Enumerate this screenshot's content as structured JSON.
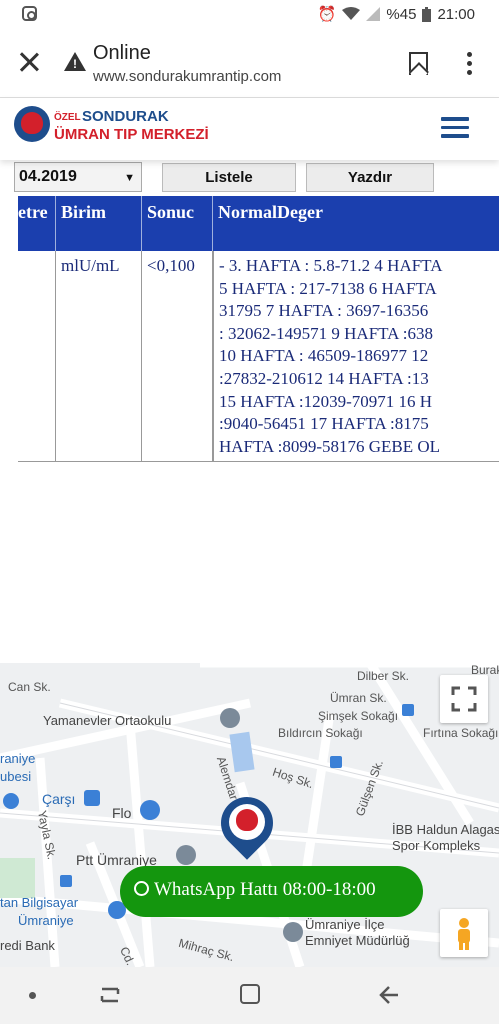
{
  "status_bar": {
    "battery": "%45",
    "time": "21:00"
  },
  "browser": {
    "title": "Online",
    "url": "www.sondurakumrantip.com"
  },
  "site": {
    "logo_ozel": "ÖZEL",
    "logo_sondurak": "SONDURAK",
    "logo_umran": "ÜMRAN TIP MERKEZİ"
  },
  "controls": {
    "date_value": "04.2019",
    "list_button": "Listele",
    "print_button": "Yazdır"
  },
  "table": {
    "headers": {
      "param": "etre",
      "unit": "Birim",
      "result": "Sonuc",
      "normal": "NormalDeger"
    },
    "row": {
      "unit": "mlU/mL",
      "result": "<0,100",
      "normal_lines": [
        "- 3. HAFTA : 5.8-71.2 4 HAFTA",
        "5 HAFTA : 217-7138 6 HAFTA",
        "31795 7 HAFTA : 3697-16356",
        ": 32062-149571 9 HAFTA :638",
        "10 HAFTA : 46509-186977 12",
        ":27832-210612 14 HAFTA :13",
        "15 HAFTA :12039-70971 16 H",
        ":9040-56451 17 HAFTA :8175",
        "HAFTA :8099-58176 GEBE OL"
      ]
    }
  },
  "map": {
    "labels": {
      "can_sk": "Can Sk.",
      "dilber_sk": "Dilber Sk.",
      "umran_sk": "Ümran Sk.",
      "simsek_sokagi": "Şimşek Sokağı",
      "yamanevler": "Yamanevler Ortaokulu",
      "bildircin": "Bıldırcın Sokağı",
      "firtina": "Fırtına Sokağı",
      "umraniye": "raniye",
      "subesi": "ubesi",
      "carsi": "Çarşı",
      "flo": "Flo",
      "alemdar": "Alemdar Sk.",
      "hos_sk": "Hoş Sk.",
      "gulsen": "Gülşen Sk.",
      "ibb": "İBB Haldun Alagas",
      "spor": "Spor Kompleks",
      "yayla": "Yayla Sk.",
      "ptt": "Ptt Ümraniye",
      "bilgisayar": "tan Bilgisayar",
      "umraniye2": "Ümraniye",
      "kredi": "redi Bank",
      "ilce": "Ümraniye İlçe",
      "emniyet": "Emniyet Müdürlüğ",
      "mihrac": "Mihraç Sk.",
      "cd": "Cd.",
      "burak": "Burak"
    },
    "whatsapp": "WhatsApp Hattı 08:00-18:00"
  }
}
